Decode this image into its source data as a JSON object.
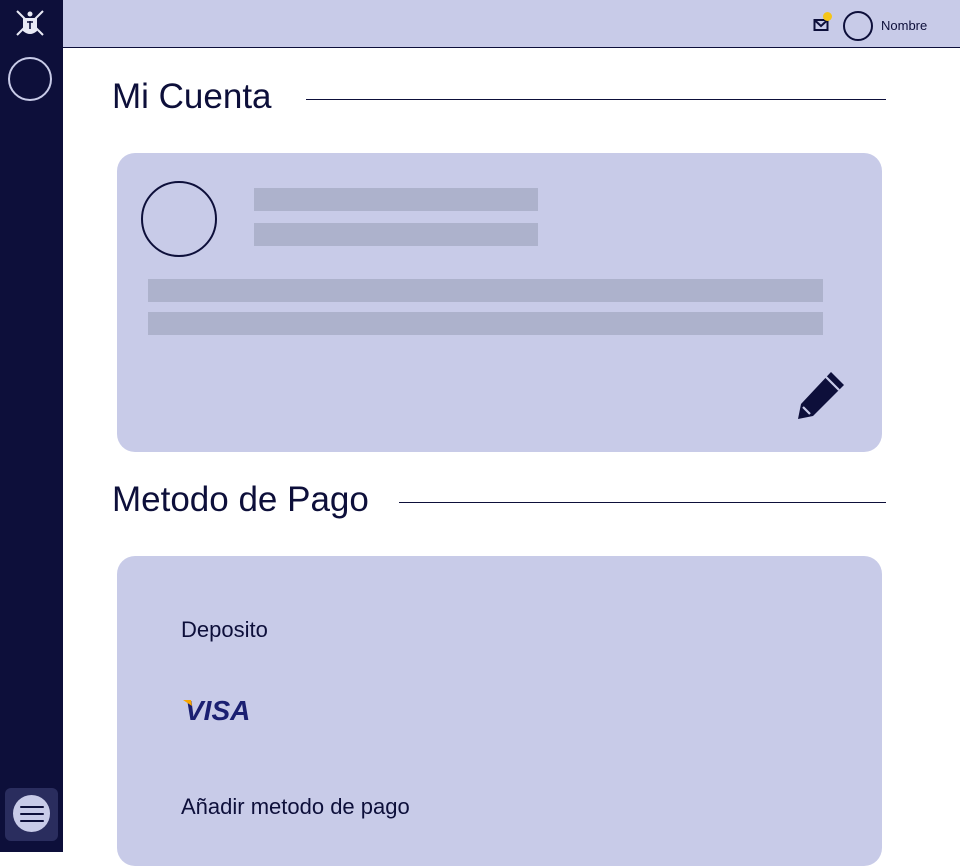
{
  "header": {
    "user_name": "Nombre"
  },
  "sections": {
    "account_title": "Mi Cuenta",
    "payment_title": "Metodo de Pago"
  },
  "payment": {
    "methods": [
      "Deposito",
      "VISA"
    ],
    "add_label": "Añadir metodo de pago"
  },
  "icons": [
    "app-logo-icon",
    "mail-icon",
    "edit-pencil-icon",
    "menu-icon",
    "visa-logo"
  ],
  "colors": {
    "sidebar": "#0d0f3a",
    "card": "#c8cbe8",
    "skeleton": "#adb2cc",
    "notification": "#f5c518",
    "visa_blue": "#1a1f71",
    "visa_gold": "#f7a600"
  }
}
